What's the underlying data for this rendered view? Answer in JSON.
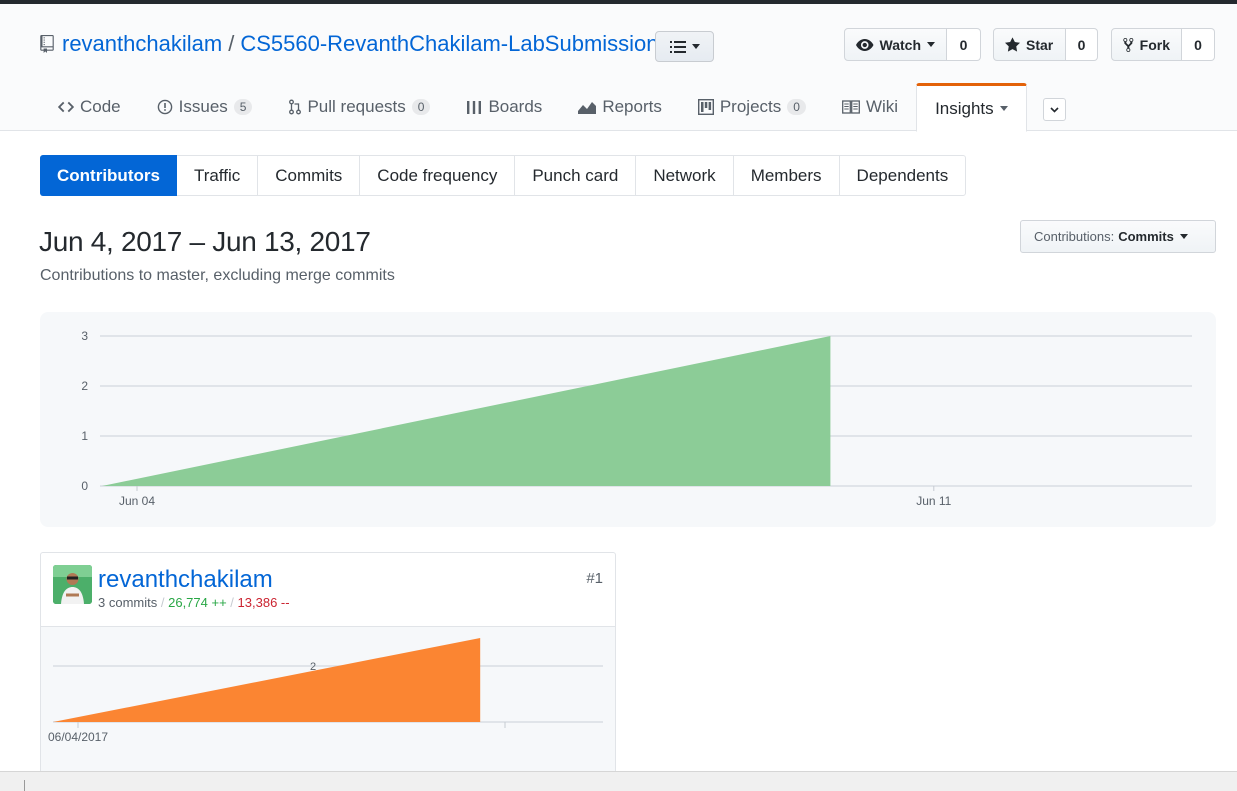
{
  "repo": {
    "owner": "revanthchakilam",
    "separator": "/",
    "name": "CS5560-RevanthChakilam-LabSubmission"
  },
  "actions": {
    "watch": {
      "label": "Watch",
      "count": "0"
    },
    "star": {
      "label": "Star",
      "count": "0"
    },
    "fork": {
      "label": "Fork",
      "count": "0"
    }
  },
  "tabs": [
    {
      "label": "Code",
      "icon": "code-icon"
    },
    {
      "label": "Issues",
      "icon": "issue-icon",
      "counter": "5"
    },
    {
      "label": "Pull requests",
      "icon": "pull-request-icon",
      "counter": "0"
    },
    {
      "label": "Boards",
      "icon": "boards-icon"
    },
    {
      "label": "Reports",
      "icon": "graph-icon"
    },
    {
      "label": "Projects",
      "icon": "project-icon",
      "counter": "0"
    },
    {
      "label": "Wiki",
      "icon": "book-icon"
    },
    {
      "label": "Insights",
      "icon": "",
      "active": true
    }
  ],
  "subnav": [
    "Contributors",
    "Traffic",
    "Commits",
    "Code frequency",
    "Punch card",
    "Network",
    "Members",
    "Dependents"
  ],
  "header": {
    "date_range": "Jun 4, 2017 – Jun 13, 2017",
    "subtitle": "Contributions to master, excluding merge commits"
  },
  "contrib_select": {
    "prefix": "Contributions:",
    "value": "Commits"
  },
  "colors": {
    "accent": "#0366d6",
    "area_main": "#8ccc97",
    "area_user": "#fb8532",
    "insights_border": "#e36209"
  },
  "chart_data": [
    {
      "type": "area",
      "x": [
        "2017-06-04",
        "2017-06-10"
      ],
      "y": [
        0,
        3
      ],
      "ylim": [
        0,
        3
      ],
      "yticks": [
        "0",
        "1",
        "2",
        "3"
      ],
      "xticks": [
        "Jun 04",
        "Jun 11"
      ],
      "grid": true
    },
    {
      "type": "area",
      "x": [
        "2017-06-04",
        "2017-06-10"
      ],
      "y": [
        0,
        3
      ],
      "yticks": [
        "2"
      ],
      "xticks": [
        "06/04/2017"
      ],
      "grid": true
    }
  ],
  "contributor": {
    "username": "revanthchakilam",
    "commits": "3 commits",
    "sep": "/",
    "additions": "26,774 ++",
    "deletions": "13,386 --",
    "rank": "#1"
  }
}
